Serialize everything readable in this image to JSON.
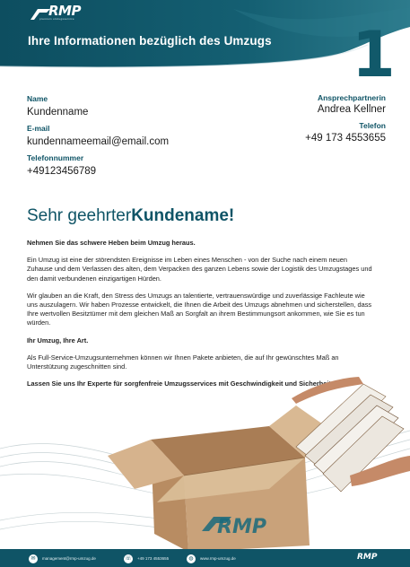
{
  "header": {
    "logo": "RMP",
    "logo_tagline": "premium umzugsservice",
    "title": "Ihre Informationen bezüglich des Umzugs",
    "page_number": "1"
  },
  "customer": {
    "name_label": "Name",
    "name_value": "Kundenname",
    "email_label": "E-mail",
    "email_value": "kundennameemail@email.com",
    "phone_label": "Telefonnummer",
    "phone_value": "+49123456789"
  },
  "contact": {
    "person_label": "Ansprechpartnerin",
    "person_value": "Andrea Kellner",
    "phone_label": "Telefon",
    "phone_value": "+49 173 4553655"
  },
  "greeting": {
    "prefix": "Sehr geehrter",
    "name": "Kundename!"
  },
  "body": {
    "p1": "Nehmen Sie das schwere Heben beim Umzug heraus.",
    "p2": "Ein Umzug ist eine der störendsten Ereignisse im Leben eines Menschen - von der Suche nach einem neuen Zuhause und dem Verlassen des alten, dem Verpacken des ganzen Lebens sowie der Logistik des Umzugstages und den damit verbundenen einzigartigen Hürden.",
    "p3": "Wir glauben an die Kraft, den Stress des Umzugs an talentierte, vertrauenswürdige und zuverlässige Fachleute wie uns auszulagern. Wir haben Prozesse entwickelt, die Ihnen die Arbeit des Umzugs abnehmen und sicherstellen, dass Ihre wertvollen Besitztümer mit dem gleichen Maß an Sorgfalt an ihrem Bestimmungsort ankommen, wie Sie es tun würden.",
    "p4": "Ihr Umzug, Ihre Art.",
    "p5": "Als Full-Service-Umzugsunternehmen können wir Ihnen Pakete anbieten, die auf Ihr gewünschtes Maß an Unterstützung zugeschnitten sind.",
    "p6": "Lassen Sie uns Ihr Experte für sorgfenfreie Umzugsservices mit Geschwindigkeit und Sicherheit sein."
  },
  "box_logo": "RMP",
  "footer": {
    "email": "management@rmp-umzug.de",
    "phone": "+49 173 4553655",
    "website": "www.rmp-umzug.de",
    "logo": "RMP",
    "email_icon": "mail-icon",
    "phone_icon": "phone-icon",
    "web_icon": "globe-icon"
  },
  "colors": {
    "primary": "#0f5466",
    "box": "#c9a27a"
  }
}
